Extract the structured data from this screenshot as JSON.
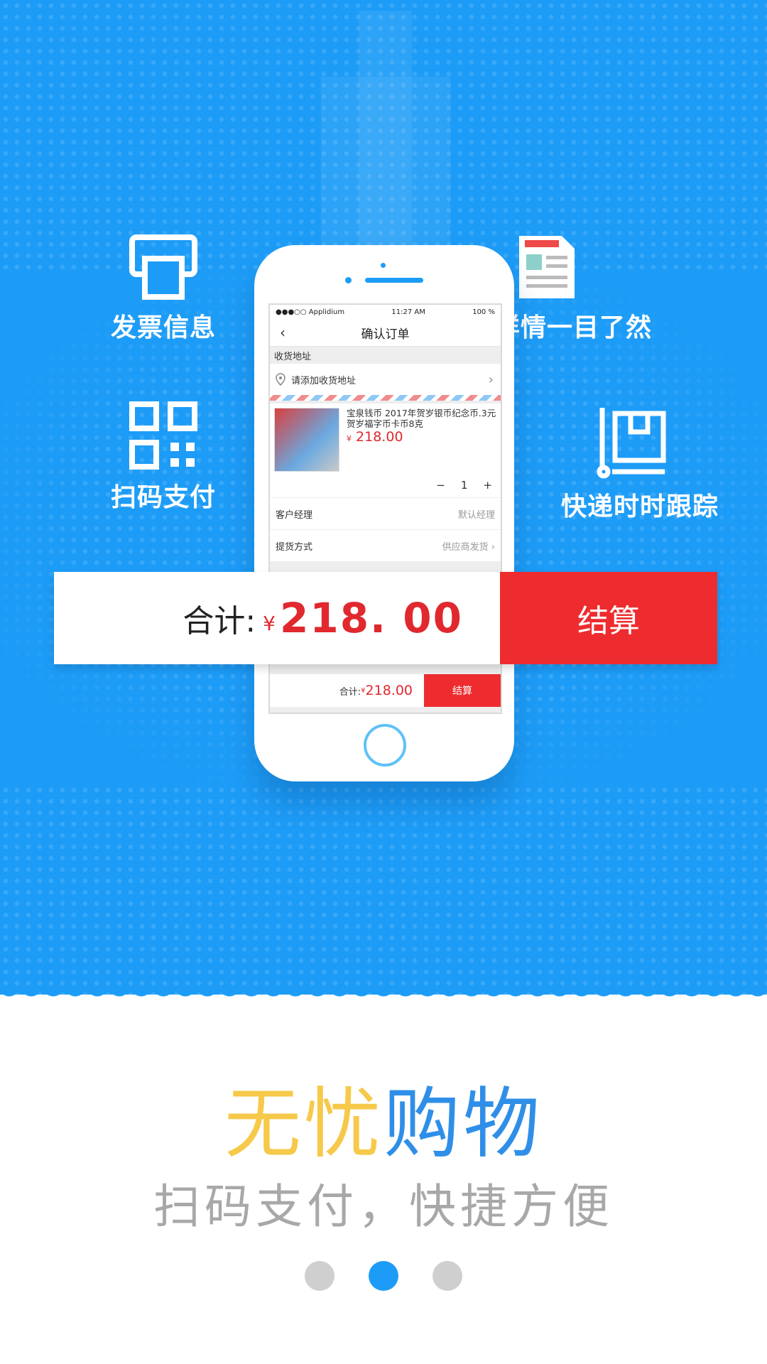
{
  "features": {
    "invoice": "发票信息",
    "order_detail": "订单详情一目了然",
    "scan_pay": "扫码支付",
    "tracking": "快递时时跟踪"
  },
  "phone": {
    "status": {
      "carrier": "●●●○○ Applidium",
      "time": "11:27 AM",
      "battery": "100 %"
    },
    "nav_title": "确认订单",
    "back": "‹",
    "address_section": "收货地址",
    "address_placeholder": "请添加收货地址",
    "product": {
      "name": "宝泉钱币 2017年贺岁银币纪念币.3元贺岁福字币卡币8克",
      "currency": "¥",
      "price": "218.00",
      "qty_minus": "−",
      "qty": "1",
      "qty_plus": "+"
    },
    "rows": [
      {
        "label": "客户经理",
        "value": "默认经理"
      },
      {
        "label": "提货方式",
        "value": "供应商发货 ›"
      }
    ],
    "footer": {
      "total_label": "合计:",
      "currency": "¥",
      "total": "218.00",
      "pay": "结算"
    }
  },
  "callout": {
    "total_label": "合计:",
    "currency": "¥",
    "total": "218. 00",
    "pay": "结算"
  },
  "headline": {
    "part1": "无忧",
    "part2": "购物"
  },
  "subtitle": "扫码支付，快捷方便",
  "pager": {
    "count": 3,
    "active": 2
  },
  "colors": {
    "hero": "#1d9cf7",
    "red": "#ee2c2f",
    "yellow": "#f6c94a",
    "blue": "#2f8fe8"
  }
}
